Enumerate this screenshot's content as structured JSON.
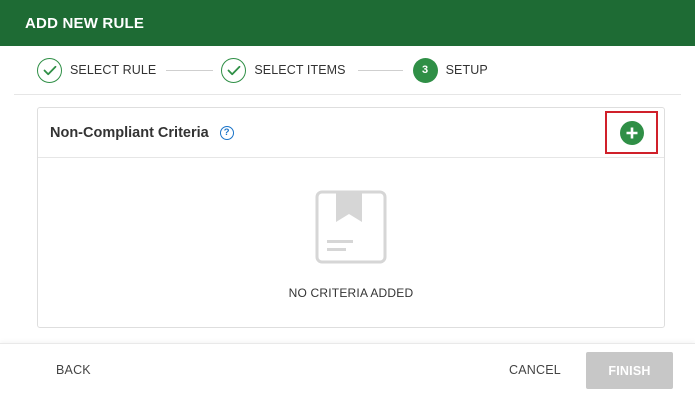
{
  "dialog": {
    "title": "ADD NEW RULE"
  },
  "stepper": {
    "steps": [
      {
        "label": "SELECT RULE",
        "state": "done",
        "icon": "check-icon"
      },
      {
        "label": "SELECT ITEMS",
        "state": "done",
        "icon": "check-icon"
      },
      {
        "label": "SETUP",
        "state": "current",
        "number": "3"
      }
    ]
  },
  "criteria_panel": {
    "title": "Non-Compliant Criteria",
    "help_icon": "question-circle-icon",
    "help_glyph": "?",
    "add_icon": "plus-circle-icon",
    "empty_icon": "bookmark-box-icon",
    "empty_message": "NO CRITERIA ADDED"
  },
  "footer": {
    "back_label": "BACK",
    "cancel_label": "CANCEL",
    "finish_label": "FINISH",
    "finish_disabled": true
  },
  "colors": {
    "header_bg": "#1e6b34",
    "accent_green": "#2f8f46",
    "highlight_red": "#d0202a",
    "help_blue": "#1a73c8",
    "disabled_gray": "#c7c7c7"
  }
}
